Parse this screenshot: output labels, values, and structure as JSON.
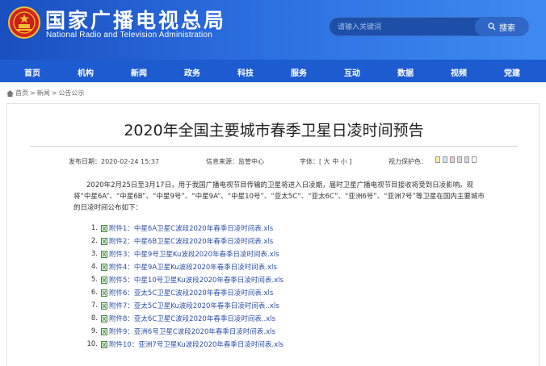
{
  "header": {
    "title_cn": "国家广播电视总局",
    "title_en": "National Radio and Television Administration",
    "search_placeholder": "请输入关键词",
    "search_button": "搜索"
  },
  "nav": [
    "首页",
    "机构",
    "新闻",
    "政务",
    "科技",
    "服务",
    "互动",
    "数据",
    "视频",
    "党建"
  ],
  "breadcrumb": {
    "home": "首页",
    "sep1": ">",
    "news": "新闻",
    "sep2": ">",
    "current": "公告公示"
  },
  "article": {
    "title": "2020年全国主要城市春季卫星日凌时间预告",
    "date": "发布日期：2020-02-24 15:37",
    "source": "信息来源：监管中心",
    "font_size": "字体：[ 大 中 小 ]",
    "vision": "视力保护色：",
    "body": "2020年2月25日至3月17日，用于我国广播电视节目传输的卫星将进入日凌期，届时卫星广播电视节目接收将受到日凌影响。现将“中星6A”、“中星6B”、“中星9号”、“中星9A”、“中星10号”、“亚太5C”、“亚太6C”、“亚洲6号”、“亚洲7号”等卫星在国内主要城市的日凌时间公布如下：",
    "swatch_colors": [
      "#f8f0a0",
      "#c9e7f8",
      "#f3c6d6",
      "#d8d8d8",
      "#e8cdf2",
      "#ffffff"
    ],
    "attachments": [
      {
        "num": "1.",
        "label": "附件1：中星6A卫星C波段2020年春季日凌时间表.xls"
      },
      {
        "num": "2.",
        "label": "附件2：中星6B卫星C波段2020年春季日凌时间表.xls"
      },
      {
        "num": "3.",
        "label": "附件3：中星9号卫星Ku波段2020年春季日凌时间表.xls"
      },
      {
        "num": "4.",
        "label": "附件4：中星9A卫星Ku波段2020年春季日凌时间表.xls"
      },
      {
        "num": "5.",
        "label": "附件5：中星10号卫星Ku波段2020年春季日凌时间表.xls"
      },
      {
        "num": "6.",
        "label": "附件6：亚太5C卫星C波段2020年春季日凌时间表.xls"
      },
      {
        "num": "7.",
        "label": "附件7：亚太5C卫星Ku波段2020年春季日凌时间表..xls"
      },
      {
        "num": "8.",
        "label": "附件8：亚太6C卫星C波段2020年春季日凌时间表..xls"
      },
      {
        "num": "9.",
        "label": "附件9：亚洲6号卫星C波段2020年春季日凌时间表.xls"
      },
      {
        "num": "10.",
        "label": "附件10：亚洲7号卫星Ku波段2020年春季日凌时间表.xls"
      }
    ]
  }
}
